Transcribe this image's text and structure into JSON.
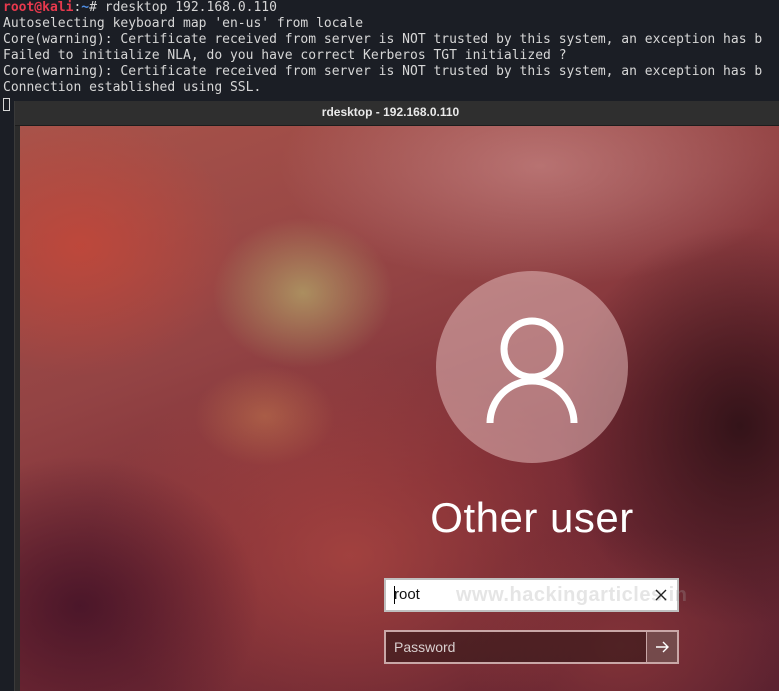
{
  "terminal": {
    "prompt_user": "root@kali",
    "prompt_sep": ":",
    "prompt_path": "~",
    "prompt_symbol": "# ",
    "command": "rdesktop 192.168.0.110",
    "output": [
      "Autoselecting keyboard map 'en-us' from locale",
      "Core(warning): Certificate received from server is NOT trusted by this system, an exception has b",
      "Failed to initialize NLA, do you have correct Kerberos TGT initialized ?",
      "Core(warning): Certificate received from server is NOT trusted by this system, an exception has b",
      "Connection established using SSL."
    ]
  },
  "rdesktop": {
    "title": "rdesktop - 192.168.0.110"
  },
  "login": {
    "avatar_icon": "user-avatar-icon",
    "user_label": "Other user",
    "username_value": "root",
    "password_placeholder": "Password",
    "clear_icon": "close-icon",
    "submit_icon": "arrow-right-icon",
    "watermark": "www.hackingarticles.in"
  },
  "colors": {
    "terminal_bg": "#1b1e25",
    "prompt_user": "#e8394d",
    "prompt_path": "#4f8fe6",
    "terminal_text": "#d6d6d6"
  }
}
